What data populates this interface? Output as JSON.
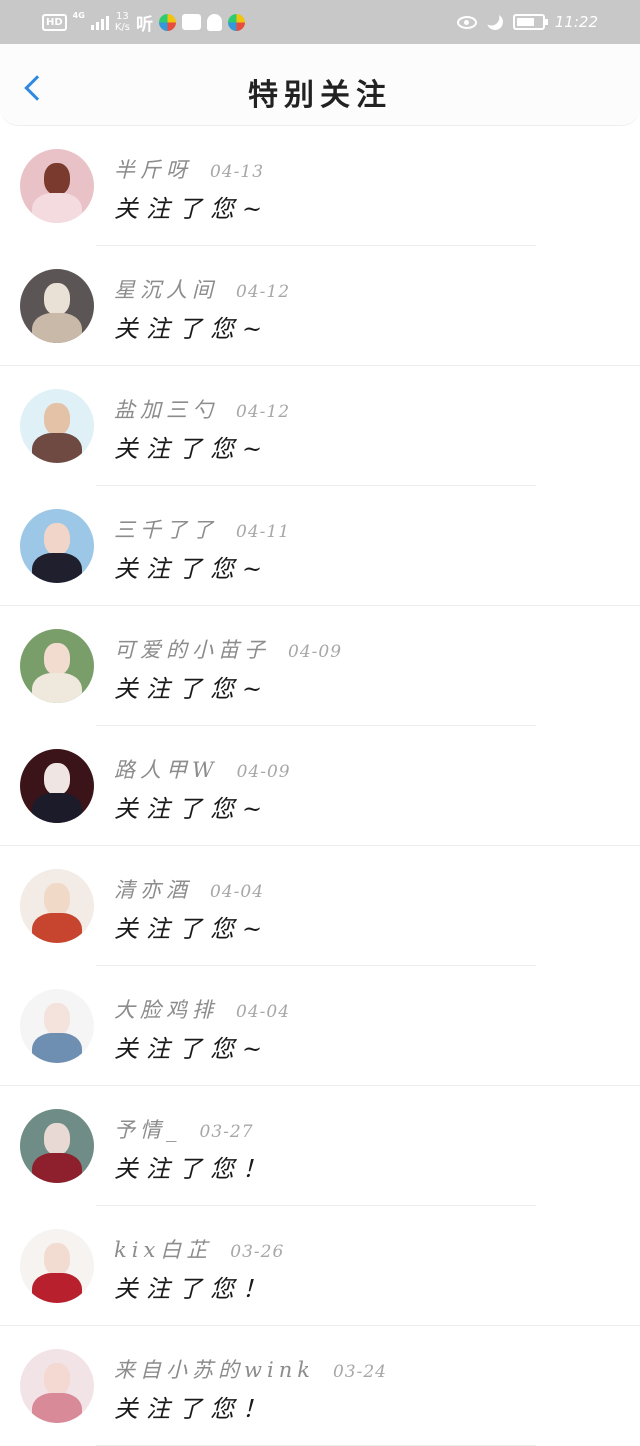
{
  "status_bar": {
    "hd_label": "HD",
    "network_label": "4G",
    "speed_value": "13",
    "speed_unit": "K/s",
    "app_label": "听",
    "time": "11:22"
  },
  "header": {
    "title": "特别关注"
  },
  "notifications": [
    {
      "name": "半斤呀",
      "date": "04-13",
      "message": "关注了您~",
      "colors": [
        "#e9c2c8",
        "#7a3b2e",
        "#f3dbe0"
      ]
    },
    {
      "name": "星沉人间",
      "date": "04-12",
      "message": "关注了您~",
      "colors": [
        "#5c5555",
        "#e9e0d6",
        "#c9b9a9"
      ]
    },
    {
      "name": "盐加三勺",
      "date": "04-12",
      "message": "关注了您~",
      "colors": [
        "#dff0f6",
        "#e3c2a7",
        "#6e4a43"
      ]
    },
    {
      "name": "三千了了",
      "date": "04-11",
      "message": "关注了您~",
      "colors": [
        "#9cc7e6",
        "#f0d5c8",
        "#1f1f2e"
      ]
    },
    {
      "name": "可爱的小苗子",
      "date": "04-09",
      "message": "关注了您~",
      "colors": [
        "#7a9e6a",
        "#f2dcd0",
        "#efe8dc"
      ]
    },
    {
      "name": "路人甲W",
      "date": "04-09",
      "message": "关注了您~",
      "colors": [
        "#3a1418",
        "#efe5e3",
        "#1b1b29"
      ]
    },
    {
      "name": "清亦酒",
      "date": "04-04",
      "message": "关注了您~",
      "colors": [
        "#f3ebe6",
        "#f1d9c8",
        "#c7452f"
      ]
    },
    {
      "name": "大脸鸡排",
      "date": "04-04",
      "message": "关注了您~",
      "colors": [
        "#f5f5f5",
        "#f4e2dc",
        "#6e8fb1"
      ]
    },
    {
      "name": "予情_",
      "date": "03-27",
      "message": "关注了您！",
      "colors": [
        "#6f8c86",
        "#e9d9d4",
        "#8e1f2c"
      ]
    },
    {
      "name": "kix白芷",
      "date": "03-26",
      "message": "关注了您！",
      "colors": [
        "#f6f3f1",
        "#f2dcd2",
        "#b7202c"
      ]
    },
    {
      "name": "来自小苏的wink",
      "date": "03-24",
      "message": "关注了您！",
      "colors": [
        "#f2e3e7",
        "#f4d8d2",
        "#d98a98"
      ]
    }
  ]
}
